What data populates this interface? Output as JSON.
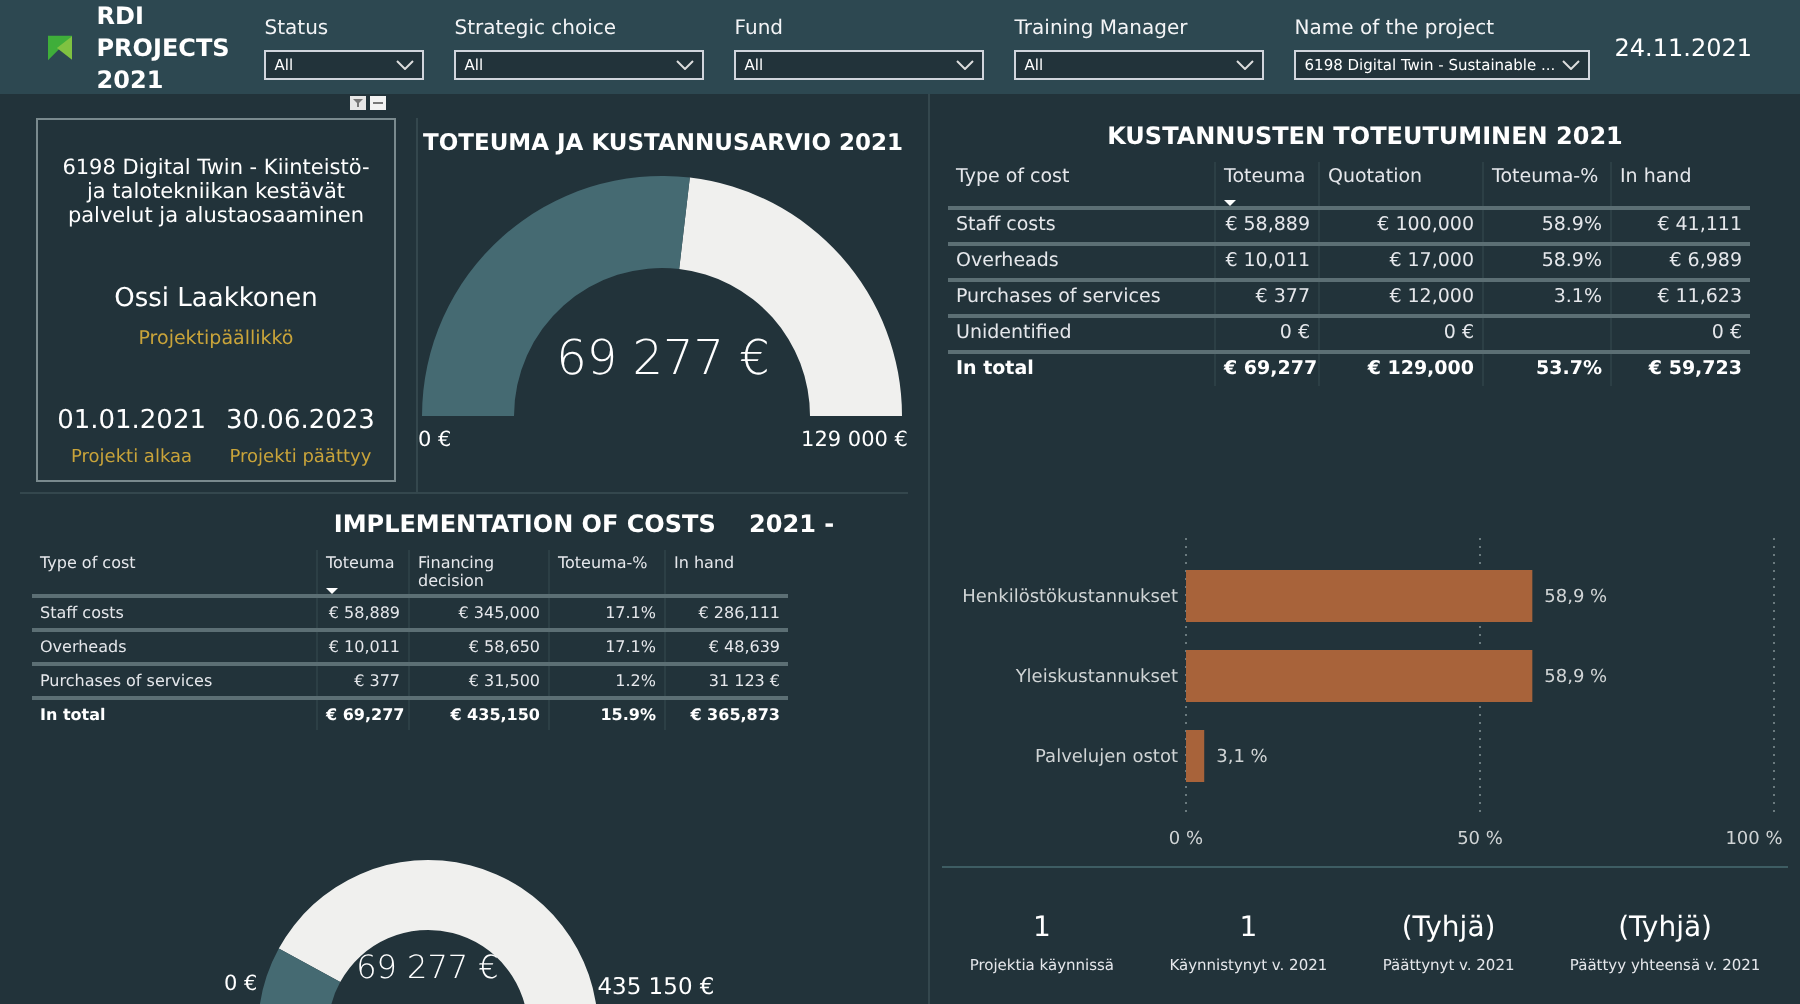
{
  "header": {
    "title": "RDI PROJECTS 2021",
    "date": "24.11.2021",
    "filters": [
      {
        "label": "Status",
        "value": "All"
      },
      {
        "label": "Strategic choice",
        "value": "All"
      },
      {
        "label": "Fund",
        "value": "All"
      },
      {
        "label": "Training Manager",
        "value": "All"
      },
      {
        "label": "Name of the project",
        "value": "6198 Digital Twin - Sustainable ..."
      }
    ]
  },
  "project_card": {
    "name": "6198 Digital Twin - Kiinteistö- ja talotekniikan kestävät palvelut ja alustaosaaminen",
    "manager": "Ossi Laakkonen",
    "manager_role": "Projektipäällikkö",
    "dates": [
      {
        "value": "01.01.2021",
        "label": "Projekti alkaa"
      },
      {
        "value": "30.06.2023",
        "label": "Projekti päättyy"
      }
    ]
  },
  "gauge_top": {
    "title": "TOTEUMA JA KUSTANNUSARVIO 2021",
    "value": "69 277 €",
    "min": "0 €",
    "max": "129 000 €"
  },
  "implementation_table": {
    "title": "IMPLEMENTATION OF COSTS    2021 -",
    "columns": [
      {
        "label": "Type of cost",
        "sorted": false
      },
      {
        "label": "Toteuma",
        "sorted": true
      },
      {
        "label": "Financing decision",
        "sorted": false
      },
      {
        "label": "Toteuma-%",
        "sorted": false
      },
      {
        "label": "In hand",
        "sorted": false
      }
    ],
    "rows": [
      {
        "kind": "row",
        "cells": [
          "Staff costs",
          "€ 58,889",
          "€ 345,000",
          "17.1%",
          "€ 286,111"
        ]
      },
      {
        "kind": "row",
        "cells": [
          "Overheads",
          "€ 10,011",
          "€ 58,650",
          "17.1%",
          "€ 48,639"
        ]
      },
      {
        "kind": "row",
        "cells": [
          "Purchases of services",
          "€ 377",
          "€ 31,500",
          "1.2%",
          "31 123 €"
        ]
      },
      {
        "kind": "total",
        "cells": [
          "In total",
          "€ 69,277",
          "€ 435,150",
          "15.9%",
          "€ 365,873"
        ]
      }
    ]
  },
  "gauge_bottom": {
    "value": "69 277 €",
    "min": "0 €",
    "max": "435 150 €"
  },
  "costs_table": {
    "title": "KUSTANNUSTEN TOTEUTUMINEN 2021",
    "columns": [
      {
        "label": "Type of cost",
        "sorted": false
      },
      {
        "label": "Toteuma",
        "sorted": true
      },
      {
        "label": "Quotation",
        "sorted": false
      },
      {
        "label": "Toteuma-%",
        "sorted": false
      },
      {
        "label": "In hand",
        "sorted": false
      }
    ],
    "rows": [
      {
        "kind": "row",
        "cells": [
          "Staff costs",
          "€ 58,889",
          "€ 100,000",
          "58.9%",
          "€ 41,111"
        ]
      },
      {
        "kind": "row",
        "cells": [
          "Overheads",
          "€ 10,011",
          "€ 17,000",
          "58.9%",
          "€ 6,989"
        ]
      },
      {
        "kind": "row",
        "cells": [
          "Purchases of services",
          "€ 377",
          "€ 12,000",
          "3.1%",
          "€ 11,623"
        ]
      },
      {
        "kind": "row",
        "cells": [
          "Unidentified",
          "0 €",
          "0 €",
          "",
          "0 €"
        ]
      },
      {
        "kind": "total",
        "cells": [
          "In total",
          "€ 69,277",
          "€ 129,000",
          "53.7%",
          "€ 59,723"
        ]
      }
    ]
  },
  "bar_chart": {
    "chart_data": {
      "type": "bar",
      "orientation": "horizontal",
      "categories": [
        "Henkilöstökustannukset",
        "Yleiskustannukset",
        "Palvelujen ostot"
      ],
      "values": [
        58.9,
        58.9,
        3.1
      ],
      "value_labels": [
        "58,9 %",
        "58,9 %",
        "3,1 %"
      ],
      "xlim": [
        0,
        100
      ],
      "xticks": [
        {
          "value": 0,
          "label": "0 %"
        },
        {
          "value": 50,
          "label": "50 %"
        },
        {
          "value": 100,
          "label": "100 %"
        }
      ]
    }
  },
  "kpis": [
    {
      "value": "1",
      "label": "Projektia käynnissä"
    },
    {
      "value": "1",
      "label": "Käynnistynyt v. 2021"
    },
    {
      "value": "(Tyhjä)",
      "label": "Päättynyt v. 2021"
    },
    {
      "value": "(Tyhjä)",
      "label": "Päättyy yhteensä v. 2021"
    }
  ]
}
